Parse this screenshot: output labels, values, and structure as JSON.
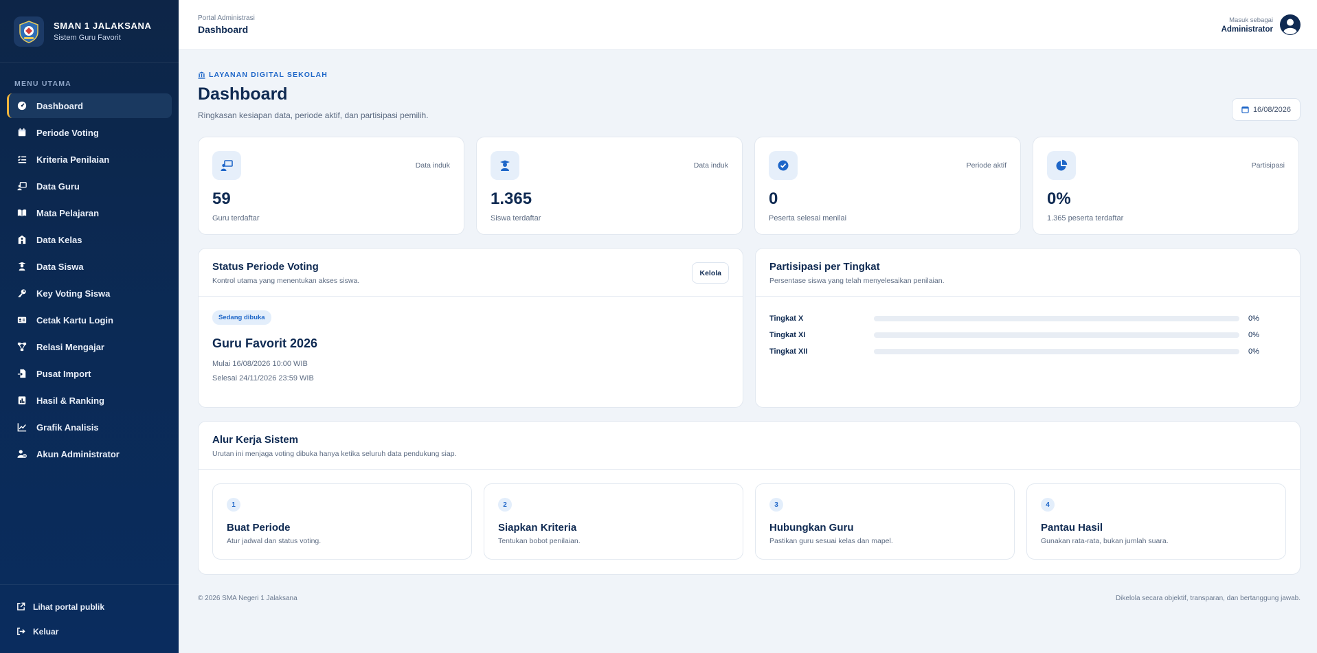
{
  "brand": {
    "title": "SMAN 1 JALAKSANA",
    "subtitle": "Sistem Guru Favorit"
  },
  "sidebar": {
    "section_label": "MENU UTAMA",
    "items": [
      {
        "label": "Dashboard",
        "icon": "gauge-icon",
        "active": true
      },
      {
        "label": "Periode Voting",
        "icon": "calendar-icon"
      },
      {
        "label": "Kriteria Penilaian",
        "icon": "list-check-icon"
      },
      {
        "label": "Data Guru",
        "icon": "chalkboard-teacher-icon"
      },
      {
        "label": "Mata Pelajaran",
        "icon": "book-open-icon"
      },
      {
        "label": "Data Kelas",
        "icon": "school-icon"
      },
      {
        "label": "Data Siswa",
        "icon": "student-icon"
      },
      {
        "label": "Key Voting Siswa",
        "icon": "key-icon"
      },
      {
        "label": "Cetak Kartu Login",
        "icon": "id-card-icon"
      },
      {
        "label": "Relasi Mengajar",
        "icon": "diagram-icon"
      },
      {
        "label": "Pusat Import",
        "icon": "file-import-icon"
      },
      {
        "label": "Hasil & Ranking",
        "icon": "ranking-icon"
      },
      {
        "label": "Grafik Analisis",
        "icon": "line-chart-icon"
      },
      {
        "label": "Akun Administrator",
        "icon": "user-gear-icon"
      }
    ],
    "footer": {
      "public_portal": "Lihat portal publik",
      "logout": "Keluar"
    }
  },
  "topbar": {
    "breadcrumb_small": "Portal Administrasi",
    "breadcrumb_title": "Dashboard",
    "user_caption": "Masuk sebagai",
    "user_name": "Administrator"
  },
  "header": {
    "eyebrow": "LAYANAN DIGITAL SEKOLAH",
    "title": "Dashboard",
    "subtitle": "Ringkasan kesiapan data, periode aktif, dan partisipasi pemilih.",
    "date": "16/08/2026"
  },
  "stats": [
    {
      "icon": "teacher-icon",
      "tag": "Data induk",
      "value": "59",
      "label": "Guru terdaftar"
    },
    {
      "icon": "graduate-icon",
      "tag": "Data induk",
      "value": "1.365",
      "label": "Siswa terdaftar"
    },
    {
      "icon": "check-circle-icon",
      "tag": "Periode aktif",
      "value": "0",
      "label": "Peserta selesai menilai"
    },
    {
      "icon": "pie-chart-icon",
      "tag": "Partisipasi",
      "value": "0%",
      "label": "1.365 peserta terdaftar"
    }
  ],
  "voting_status": {
    "title": "Status Periode Voting",
    "subtitle": "Kontrol utama yang menentukan akses siswa.",
    "manage_label": "Kelola",
    "badge": "Sedang dibuka",
    "period_name": "Guru Favorit 2026",
    "start": "Mulai 16/08/2026 10:00 WIB",
    "end": "Selesai 24/11/2026 23:59 WIB"
  },
  "participation": {
    "title": "Partisipasi per Tingkat",
    "subtitle": "Persentase siswa yang telah menyelesaikan penilaian.",
    "rows": [
      {
        "label": "Tingkat X",
        "percent": 0,
        "value_text": "0%"
      },
      {
        "label": "Tingkat XI",
        "percent": 0,
        "value_text": "0%"
      },
      {
        "label": "Tingkat XII",
        "percent": 0,
        "value_text": "0%"
      }
    ]
  },
  "workflow": {
    "title": "Alur Kerja Sistem",
    "subtitle": "Urutan ini menjaga voting dibuka hanya ketika seluruh data pendukung siap.",
    "steps": [
      {
        "num": "1",
        "title": "Buat Periode",
        "desc": "Atur jadwal dan status voting."
      },
      {
        "num": "2",
        "title": "Siapkan Kriteria",
        "desc": "Tentukan bobot penilaian."
      },
      {
        "num": "3",
        "title": "Hubungkan Guru",
        "desc": "Pastikan guru sesuai kelas dan mapel."
      },
      {
        "num": "4",
        "title": "Pantau Hasil",
        "desc": "Gunakan rata-rata, bukan jumlah suara."
      }
    ]
  },
  "footer": {
    "copyright": "© 2026 SMA Negeri 1 Jalaksana",
    "tagline": "Dikelola secara objektif, transparan, dan bertanggung jawab."
  },
  "colors": {
    "sidebar_bg": "#0d2547",
    "accent": "#1e66c8",
    "active_marker": "#f0b43c",
    "title": "#0f2a52"
  }
}
